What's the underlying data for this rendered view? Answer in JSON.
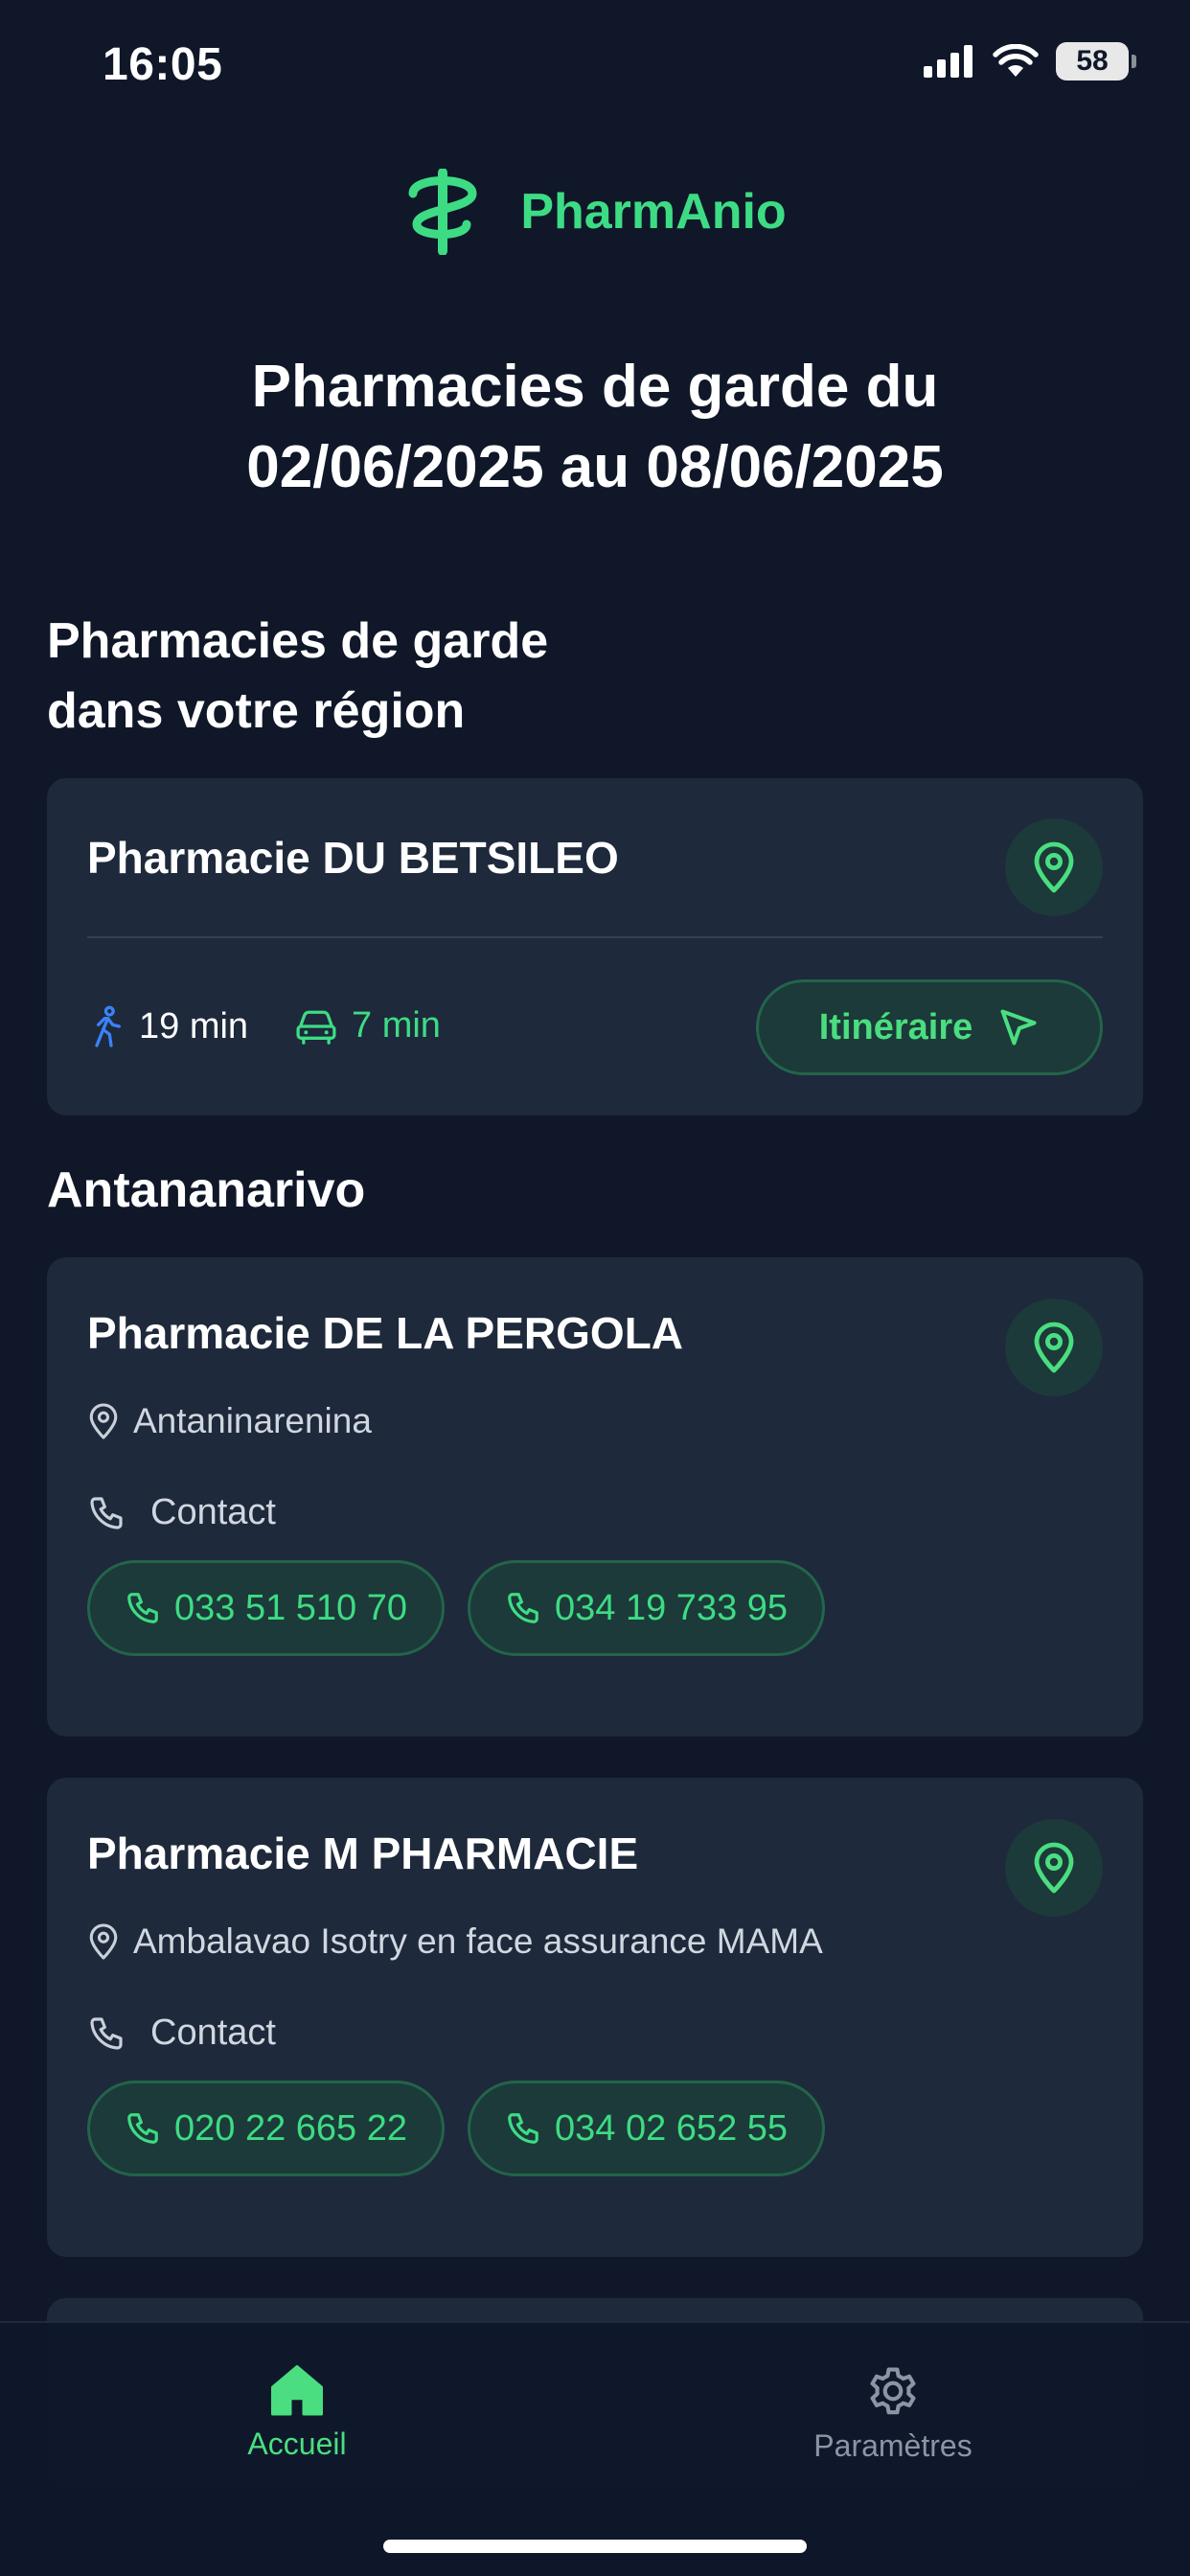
{
  "status_bar": {
    "time": "16:05",
    "battery": "58"
  },
  "brand": {
    "name": "PharmAnio",
    "logo_icon": "caduceus-icon"
  },
  "header": {
    "title_line1": "Pharmacies de garde du",
    "title_line2": "02/06/2025 au 08/06/2025"
  },
  "nearby": {
    "section_title_line1": "Pharmacies de garde",
    "section_title_line2": "dans votre région",
    "pharmacy": {
      "name": "Pharmacie DU BETSILEO",
      "walk_time": "19 min",
      "drive_time": "7 min",
      "route_label": "Itinéraire"
    }
  },
  "city": {
    "name": "Antananarivo",
    "contact_label": "Contact",
    "pharmacies": [
      {
        "name": "Pharmacie DE LA PERGOLA",
        "address": "Antaninarenina",
        "phones": [
          "033 51 510 70",
          "034 19 733 95"
        ]
      },
      {
        "name": "Pharmacie M PHARMACIE",
        "address": "Ambalavao Isotry en face assurance MAMA",
        "phones": [
          "020 22 665 22",
          "034 02 652 55"
        ]
      }
    ]
  },
  "tabs": {
    "home": "Accueil",
    "settings": "Paramètres"
  },
  "colors": {
    "background": "#0f1729",
    "card": "#1e293b",
    "accent": "#3ddc84",
    "walk_icon": "#3b82f6"
  }
}
